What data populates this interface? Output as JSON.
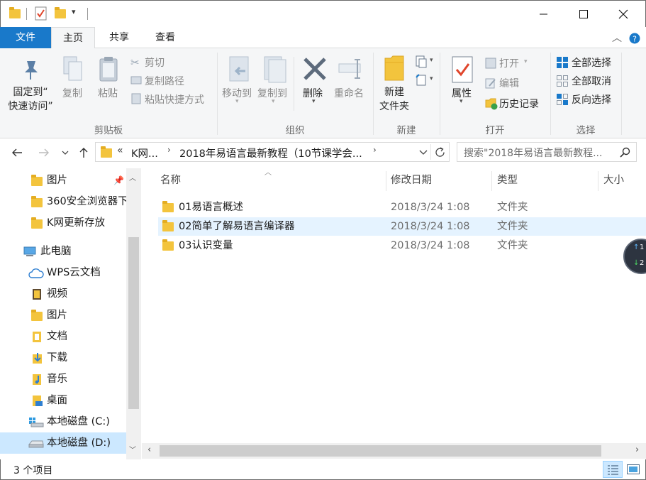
{
  "ribbon_tabs": [
    "文件",
    "主页",
    "共享",
    "查看"
  ],
  "ribbon": {
    "clipboard": {
      "pin_label_1": "固定到“",
      "pin_label_2": "快速访问”",
      "copy": "复制",
      "paste": "粘贴",
      "cut": "剪切",
      "copy_path": "复制路径",
      "paste_shortcut": "粘贴快捷方式",
      "group": "剪贴板"
    },
    "organize": {
      "move_to": "移动到",
      "copy_to": "复制到",
      "delete": "删除",
      "rename": "重命名",
      "group": "组织"
    },
    "new": {
      "new_folder_1": "新建",
      "new_folder_2": "文件夹",
      "group": "新建"
    },
    "open": {
      "properties": "属性",
      "open": "打开",
      "edit": "编辑",
      "history": "历史记录",
      "group": "打开"
    },
    "select": {
      "select_all": "全部选择",
      "select_none": "全部取消",
      "invert": "反向选择",
      "group": "选择"
    }
  },
  "address": {
    "overflow": "«",
    "crumb1": "K网...",
    "crumb2": "2018年易语言最新教程（10节课学会...",
    "search_placeholder": "搜索\"2018年易语言最新教程..."
  },
  "sidebar": {
    "items": [
      {
        "label": "图片",
        "pinned": true
      },
      {
        "label": "360安全浏览器下"
      },
      {
        "label": "K网更新存放"
      },
      {
        "label": "此电脑"
      },
      {
        "label": "WPS云文档"
      },
      {
        "label": "视频"
      },
      {
        "label": "图片"
      },
      {
        "label": "文档"
      },
      {
        "label": "下载"
      },
      {
        "label": "音乐"
      },
      {
        "label": "桌面"
      },
      {
        "label": "本地磁盘 (C:)"
      },
      {
        "label": "本地磁盘 (D:)",
        "selected": true
      }
    ]
  },
  "columns": {
    "name": "名称",
    "date": "修改日期",
    "type": "类型",
    "size": "大小"
  },
  "files": [
    {
      "name": "01易语言概述",
      "date": "2018/3/24 1:08",
      "type": "文件夹"
    },
    {
      "name": "02简单了解易语言编译器",
      "date": "2018/3/24 1:08",
      "type": "文件夹"
    },
    {
      "name": "03认识变量",
      "date": "2018/3/24 1:08",
      "type": "文件夹"
    }
  ],
  "status": {
    "count": "3 个项目"
  },
  "widget": {
    "up": "1",
    "down": "2"
  },
  "colors": {
    "file_tab": "#1979ca",
    "ribbon_bg": "#f5f6f7",
    "selection": "#cce8ff",
    "hover": "#e5f3ff",
    "folder": "#f3c43d"
  }
}
